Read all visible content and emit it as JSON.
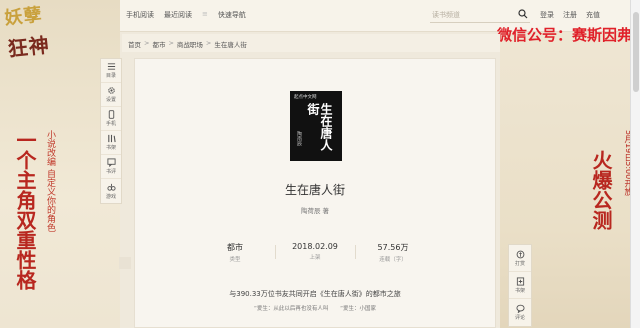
{
  "art": {
    "left_title_line1": "妖孽",
    "left_title_line2": "狂神",
    "left_vertical_big": "一个主角双重性格",
    "left_vertical_small": "小说改编 自定义你的角色",
    "right_vertical_big": "火爆公测",
    "right_vertical_small": "5月19日5:00开放"
  },
  "banner": "微信公号：赛斯因弗",
  "topbar": {
    "nav": [
      "手机阅读",
      "最近阅读",
      "快速导航"
    ],
    "search_placeholder": "读书频道",
    "links": [
      "登录",
      "注册",
      "充值"
    ]
  },
  "breadcrumb": [
    "首页",
    "都市",
    "商战职场",
    "生在唐人街"
  ],
  "toolbar": [
    {
      "label": "目录",
      "icon": "list-icon"
    },
    {
      "label": "设置",
      "icon": "gear-icon"
    },
    {
      "label": "手机",
      "icon": "phone-icon"
    },
    {
      "label": "书架",
      "icon": "bookshelf-icon"
    },
    {
      "label": "书评",
      "icon": "comment-icon"
    },
    {
      "label": "游戏",
      "icon": "gamepad-icon"
    }
  ],
  "book": {
    "cover_logo": "起点中文网",
    "cover_title": "生在唐人街",
    "cover_author": "陶南辰",
    "title": "生在唐人街",
    "author": "陶荷辰 著",
    "stats": [
      {
        "value": "都市",
        "label": "类型"
      },
      {
        "value": "2018.02.09",
        "label": "上架"
      },
      {
        "value": "57.56万",
        "label": "连载（字）"
      }
    ],
    "intro": "与390.33万位书友共同开启《生在唐人街》的都市之旅",
    "tags": [
      "“爱生：从此以后再也没有人叫",
      "“爱生：小国家"
    ]
  },
  "right_toolbar": [
    {
      "label": "打赏",
      "icon": "coin-icon"
    },
    {
      "label": "书架",
      "icon": "bookshelf-icon"
    },
    {
      "label": "评论",
      "icon": "chat-icon"
    }
  ]
}
